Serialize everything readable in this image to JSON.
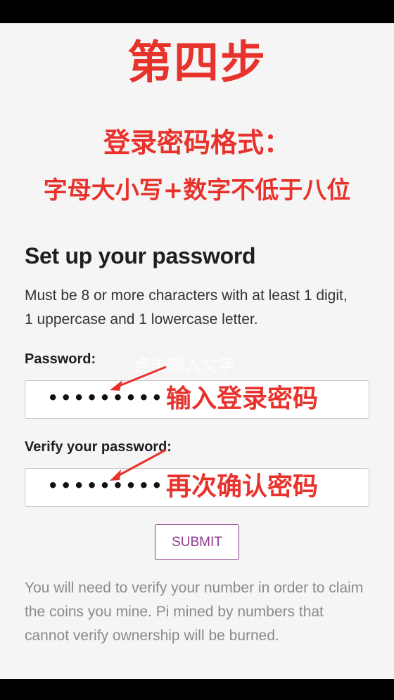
{
  "overlay": {
    "step_title": "第四步",
    "password_format_title": "登录密码格式：",
    "password_format_rule": "字母大小写+数字不低于八位",
    "watermark": "点击输入文字",
    "hint_password": "输入登录密码",
    "hint_verify": "再次确认密码",
    "accent_color": "#e8322c"
  },
  "form": {
    "title": "Set up your password",
    "description": "Must be 8 or more characters with at least 1 digit, 1 uppercase and 1 lowercase letter.",
    "password_label": "Password:",
    "password_value": "•••••••••",
    "verify_label": "Verify your password:",
    "verify_value": "•••••••••",
    "submit_label": "SUBMIT",
    "button_color": "#8e3a8c"
  },
  "footer": {
    "text": "You will need to verify your number in order to claim the coins you mine. Pi mined by numbers that cannot verify ownership will be burned."
  }
}
